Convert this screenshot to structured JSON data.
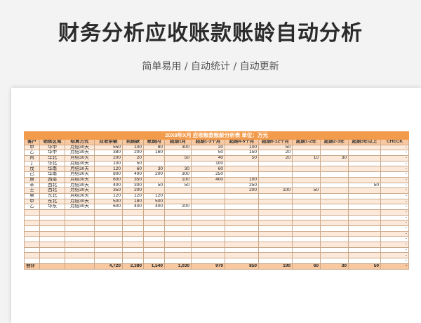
{
  "page": {
    "title": "财务分析应收账款账龄自动分析",
    "subtitle": "简单易用 / 自动统计 / 自动更新"
  },
  "sheet": {
    "banner": "20X8年X月  应收账款账龄分析表   单位：万元",
    "headers": [
      "客户",
      "销售区域",
      "结算方式",
      "应收余额",
      "到期款",
      "账期内",
      "超期1月",
      "超期1-3个月",
      "超期4-6个月",
      "超期6-12个月",
      "超期1-2年",
      "超期2-3年",
      "超期3年以上",
      "CHECK"
    ],
    "rows": [
      [
        "甲",
        "华中",
        "月结30天",
        "550",
        "100",
        "80",
        "300",
        "20",
        "100",
        "50",
        "",
        "",
        "",
        "-"
      ],
      [
        "乙",
        "华中",
        "月结30天",
        "380",
        "200",
        "160",
        "",
        "50",
        "150",
        "20",
        "",
        "",
        "",
        "-"
      ],
      [
        "丙",
        "华北",
        "月结30天",
        "200",
        "20",
        "",
        "50",
        "40",
        "50",
        "20",
        "10",
        "30",
        "",
        "-"
      ],
      [
        "丁",
        "华北",
        "月结30天",
        "100",
        "50",
        "",
        "",
        "100",
        "",
        "",
        "",
        "",
        "",
        "-"
      ],
      [
        "戊",
        "华南",
        "月结30天",
        "120",
        "60",
        "30",
        "30",
        "60",
        "",
        "",
        "",
        "",
        "",
        "-"
      ],
      [
        "己",
        "华南",
        "月结30天",
        "800",
        "400",
        "200",
        "300",
        "250",
        "",
        "",
        "",
        "",
        "",
        "-"
      ],
      [
        "庚",
        "西南",
        "月结30天",
        "600",
        "350",
        "",
        "100",
        "400",
        "100",
        "",
        "",
        "",
        "",
        "-"
      ],
      [
        "辛",
        "西北",
        "月结30天",
        "400",
        "300",
        "50",
        "50",
        "",
        "250",
        "",
        "",
        "",
        "50",
        "-"
      ],
      [
        "壬",
        "西北",
        "月结30天",
        "350",
        "200",
        "",
        "",
        "",
        "200",
        "100",
        "50",
        "",
        "",
        "-"
      ],
      [
        "癸",
        "东北",
        "月结30天",
        "120",
        "120",
        "120",
        "",
        "",
        "",
        "",
        "",
        "",
        "",
        "-"
      ],
      [
        "甲",
        "东北",
        "月结30天",
        "500",
        "180",
        "500",
        "",
        "",
        "",
        "",
        "",
        "",
        "",
        "-"
      ],
      [
        "乙",
        "华东",
        "月结30天",
        "600",
        "400",
        "400",
        "200",
        "",
        "",
        "",
        "",
        "",
        "",
        "-"
      ],
      [
        "",
        "",
        "",
        "",
        "",
        "",
        "",
        "",
        "",
        "",
        "",
        "",
        "",
        "-"
      ],
      [
        "",
        "",
        "",
        "",
        "",
        "",
        "",
        "",
        "",
        "",
        "",
        "",
        "",
        "-"
      ],
      [
        "",
        "",
        "",
        "",
        "",
        "",
        "",
        "",
        "",
        "",
        "",
        "",
        "",
        "-"
      ],
      [
        "",
        "",
        "",
        "",
        "",
        "",
        "",
        "",
        "",
        "",
        "",
        "",
        "",
        "-"
      ],
      [
        "",
        "",
        "",
        "",
        "",
        "",
        "",
        "",
        "",
        "",
        "",
        "",
        "",
        "-"
      ],
      [
        "",
        "",
        "",
        "",
        "",
        "",
        "",
        "",
        "",
        "",
        "",
        "",
        "",
        "-"
      ],
      [
        "",
        "",
        "",
        "",
        "",
        "",
        "",
        "",
        "",
        "",
        "",
        "",
        "",
        "-"
      ],
      [
        "",
        "",
        "",
        "",
        "",
        "",
        "",
        "",
        "",
        "",
        "",
        "",
        "",
        "-"
      ],
      [
        "",
        "",
        "",
        "",
        "",
        "",
        "",
        "",
        "",
        "",
        "",
        "",
        "",
        "-"
      ],
      [
        "",
        "",
        "",
        "",
        "",
        "",
        "",
        "",
        "",
        "",
        "",
        "",
        "",
        "-"
      ]
    ],
    "total": [
      "合计",
      "",
      "",
      "4,720",
      "2,380",
      "1,540",
      "1,030",
      "970",
      "850",
      "190",
      "60",
      "30",
      "50",
      "-"
    ]
  },
  "colors": {
    "accent": "#f39b4c",
    "header": "#f8c8a0",
    "stripe": "#fde9d9"
  }
}
